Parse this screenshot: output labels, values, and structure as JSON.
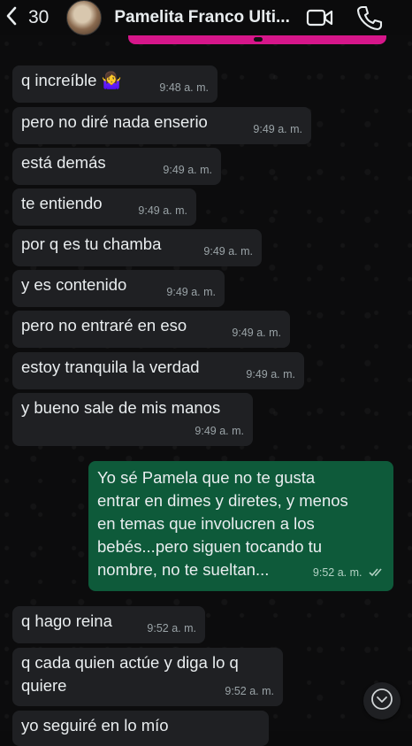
{
  "header": {
    "unread_count": "30",
    "contact_name": "Pamelita Franco Ulti..."
  },
  "messages": [
    {
      "text": "q increíble 🤷‍♀️",
      "time": "9:48 a. m."
    },
    {
      "text": "pero no diré nada enserio",
      "time": "9:49 a. m."
    },
    {
      "text": "está demás",
      "time": "9:49 a. m."
    },
    {
      "text": "te entiendo",
      "time": "9:49 a. m."
    },
    {
      "text": "por q es tu chamba",
      "time": "9:49 a. m."
    },
    {
      "text": "y es contenido",
      "time": "9:49 a. m."
    },
    {
      "text": "pero no entraré en eso",
      "time": "9:49 a. m."
    },
    {
      "text": "estoy tranquila la verdad",
      "time": "9:49 a. m."
    },
    {
      "text": "y bueno sale de mis manos",
      "time": "9:49 a. m."
    },
    {
      "text": "Yo sé Pamela que no te gusta\nentrar en dimes y diretes, y menos\nen temas que involucren a los\nbebés...pero siguen tocando tu\nnombre, no te sueltan...",
      "time": "9:52 a. m.",
      "outgoing": true
    },
    {
      "text": "q hago reina",
      "time": "9:52 a. m."
    },
    {
      "text": "q cada quien actúe y diga lo q\nquiere",
      "time": "9:52 a. m."
    },
    {
      "text": "yo seguiré en lo mío",
      "time": ""
    }
  ],
  "colors": {
    "background": "#0c0c0d",
    "incoming_bubble": "#1f2023",
    "outgoing_bubble": "#0e5a3a",
    "pinned_accent": "#d6168a"
  },
  "icons": [
    "back-arrow-icon",
    "video-call-icon",
    "phone-icon",
    "double-check-icon",
    "chevron-down-icon"
  ]
}
